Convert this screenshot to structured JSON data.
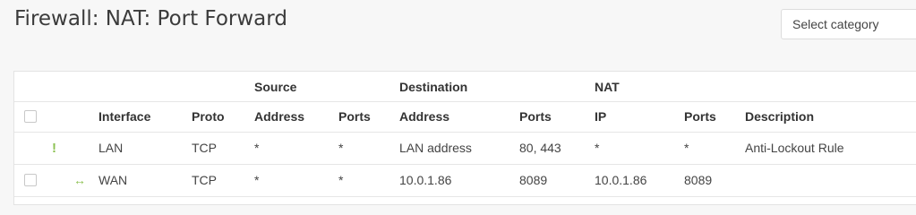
{
  "header": {
    "title": "Firewall: NAT: Port Forward",
    "category_select": "Select category"
  },
  "table": {
    "group_headers": {
      "source": "Source",
      "destination": "Destination",
      "nat": "NAT"
    },
    "columns": {
      "interface": "Interface",
      "proto": "Proto",
      "src_address": "Address",
      "src_ports": "Ports",
      "dst_address": "Address",
      "dst_ports": "Ports",
      "nat_ip": "IP",
      "nat_ports": "Ports",
      "description": "Description"
    },
    "rows": [
      {
        "status_icon": "warning-exclamation-icon",
        "interface": "LAN",
        "proto": "TCP",
        "src_address": "*",
        "src_ports": "*",
        "dst_address": "LAN address",
        "dst_ports": "80, 443",
        "nat_ip": "*",
        "nat_ports": "*",
        "description": "Anti-Lockout Rule"
      },
      {
        "status_icon": "linked-rule-arrows-icon",
        "interface": "WAN",
        "proto": "TCP",
        "src_address": "*",
        "src_ports": "*",
        "dst_address": "10.0.1.86",
        "dst_ports": "8089",
        "nat_ip": "10.0.1.86",
        "nat_ports": "8089",
        "description": ""
      }
    ]
  },
  "colors": {
    "accent_orange": "#d94f00",
    "icon_green": "#8cc152"
  }
}
